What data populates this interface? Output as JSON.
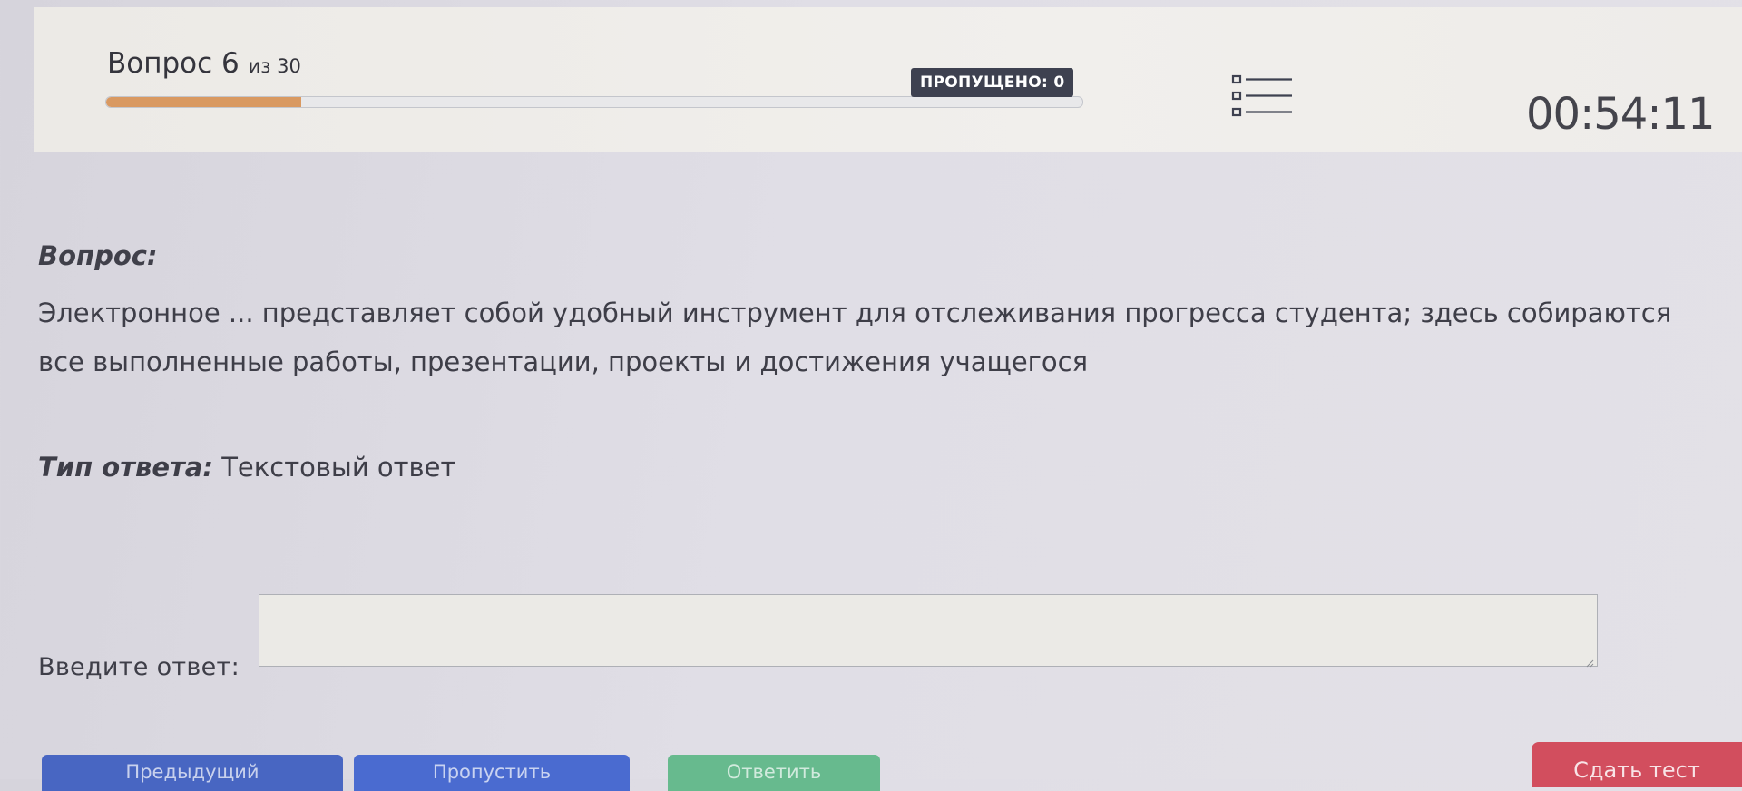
{
  "header": {
    "question_word": "Вопрос 6",
    "of_total": "из 30",
    "progress_fraction": 0.2,
    "skipped_badge": "ПРОПУЩЕНО: 0",
    "list_icon": "question-list-icon",
    "timer": "00:54:11"
  },
  "question": {
    "label": "Вопрос:",
    "text": "Электронное ... представляет собой удобный инструмент для отслеживания прогресса студента; здесь собираются все выполненные работы, презентации, проекты и достижения учащегося"
  },
  "answer_type": {
    "label": "Тип ответа:",
    "value": "Текстовый ответ"
  },
  "answer": {
    "label": "Введите ответ:",
    "value": ""
  },
  "buttons": {
    "prev": "Предыдущий",
    "skip": "Пропустить",
    "answer": "Ответить",
    "submit": "Сдать тест"
  },
  "colors": {
    "progress": "#d99961",
    "badge": "#3e4150",
    "prev_button": "#4866c2",
    "skip_button": "#4a6bd0",
    "answer_button": "#67ba8e",
    "submit_button": "#d24e5e"
  }
}
